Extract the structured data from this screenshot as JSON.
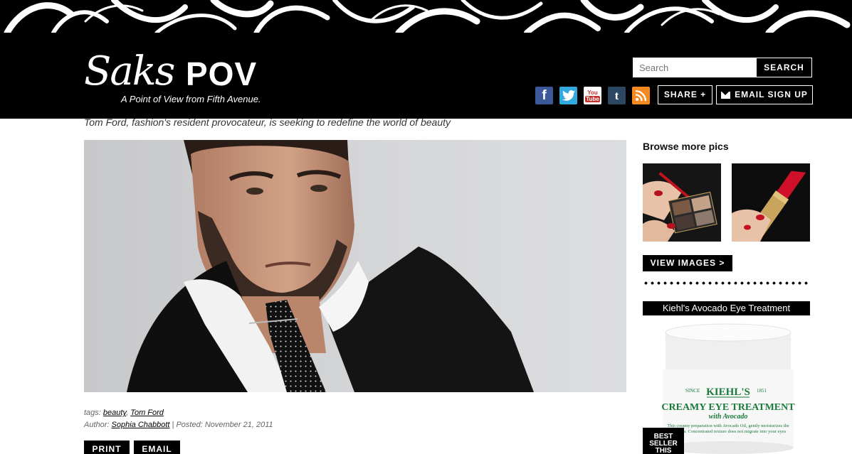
{
  "brand": {
    "script": "Saks",
    "name": "POV",
    "tagline": "A Point of View from Fifth Avenue."
  },
  "search": {
    "placeholder": "Search",
    "button_label": "SEARCH"
  },
  "social": {
    "facebook": "f",
    "twitter": "t",
    "youtube_top": "You",
    "youtube_bottom": "Tube",
    "tumblr": "t"
  },
  "actions": {
    "share_label": "SHARE +",
    "email_signup_label": "EMAIL SIGN UP"
  },
  "article": {
    "caption": "Tom Ford, fashion's resident provocateur, is seeking to redefine the world of beauty",
    "tags_label": "tags:",
    "tags": [
      "beauty",
      "Tom Ford"
    ],
    "author_label": "Author:",
    "author": "Sophia Chabbott",
    "posted": "| Posted: November 21, 2011",
    "print_label": "PRINT",
    "email_label": "EMAIL"
  },
  "sidebar": {
    "browse_title": "Browse more pics",
    "view_images_label": "VIEW IMAGES >",
    "product_title": "Kiehl's Avocado Eye Treatment",
    "product_brand": "KIEHL'S",
    "product_since": "SINCE",
    "product_year": "1851",
    "product_name": "CREAMY EYE TREATMENT",
    "product_sub": "with Avocado",
    "product_desc1": "This creamy preparation with Avocado Oil, gently moisturizes the",
    "product_desc2": "eye area. Concentrated texture does not migrate into your eyes",
    "best_seller": [
      "BEST",
      "SELLER",
      "THIS"
    ]
  },
  "colors": {
    "header_bg": "#000000",
    "facebook": "#3b5998",
    "twitter": "#33aadd",
    "youtube": "#c4302b",
    "tumblr": "#2c4762",
    "rss": "#f58a1f",
    "kiehls_green": "#1a7a3a"
  }
}
